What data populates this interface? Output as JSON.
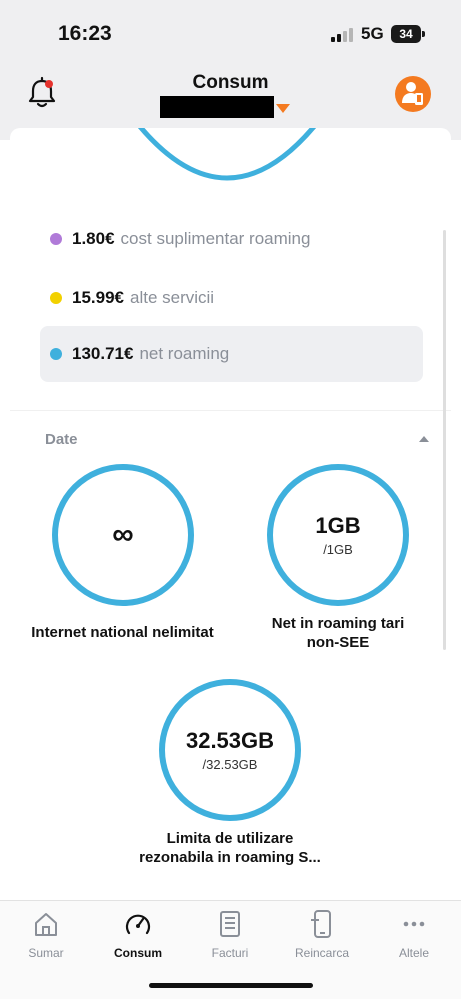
{
  "status_bar": {
    "time": "16:23",
    "network": "5G",
    "battery": "34",
    "battery_level": 0.34
  },
  "header": {
    "title": "Consum"
  },
  "colors": {
    "accent_orange": "#f47a20",
    "ring_blue": "#3fb0dd",
    "dot_purple": "#b07ad8",
    "dot_yellow": "#f2d100",
    "dot_blue": "#3fb0dd"
  },
  "legend": [
    {
      "amount": "1.80€",
      "label": "cost suplimentar roaming",
      "color": "#b07ad8"
    },
    {
      "amount": "15.99€",
      "label": "alte servicii",
      "color": "#f2d100"
    },
    {
      "amount": "130.71€",
      "label": "net roaming",
      "color": "#3fb0dd",
      "selected": true
    }
  ],
  "data_section": {
    "title": "Date",
    "gauges": [
      {
        "value": "∞",
        "limit": "",
        "caption": "Internet national nelimitat"
      },
      {
        "value": "1GB",
        "limit": "/1GB",
        "caption_line1": "Net in roaming tari",
        "caption_line2": "non-SEE"
      },
      {
        "value": "32.53GB",
        "limit": "/32.53GB",
        "caption_line1": "Limita de utilizare",
        "caption_line2": "rezonabila in roaming S..."
      }
    ]
  },
  "bottom_nav": [
    {
      "label": "Sumar",
      "icon": "home-icon"
    },
    {
      "label": "Consum",
      "icon": "gauge-icon",
      "active": true
    },
    {
      "label": "Facturi",
      "icon": "invoice-icon"
    },
    {
      "label": "Reincarca",
      "icon": "phone-topup-icon"
    },
    {
      "label": "Altele",
      "icon": "more-icon"
    }
  ]
}
